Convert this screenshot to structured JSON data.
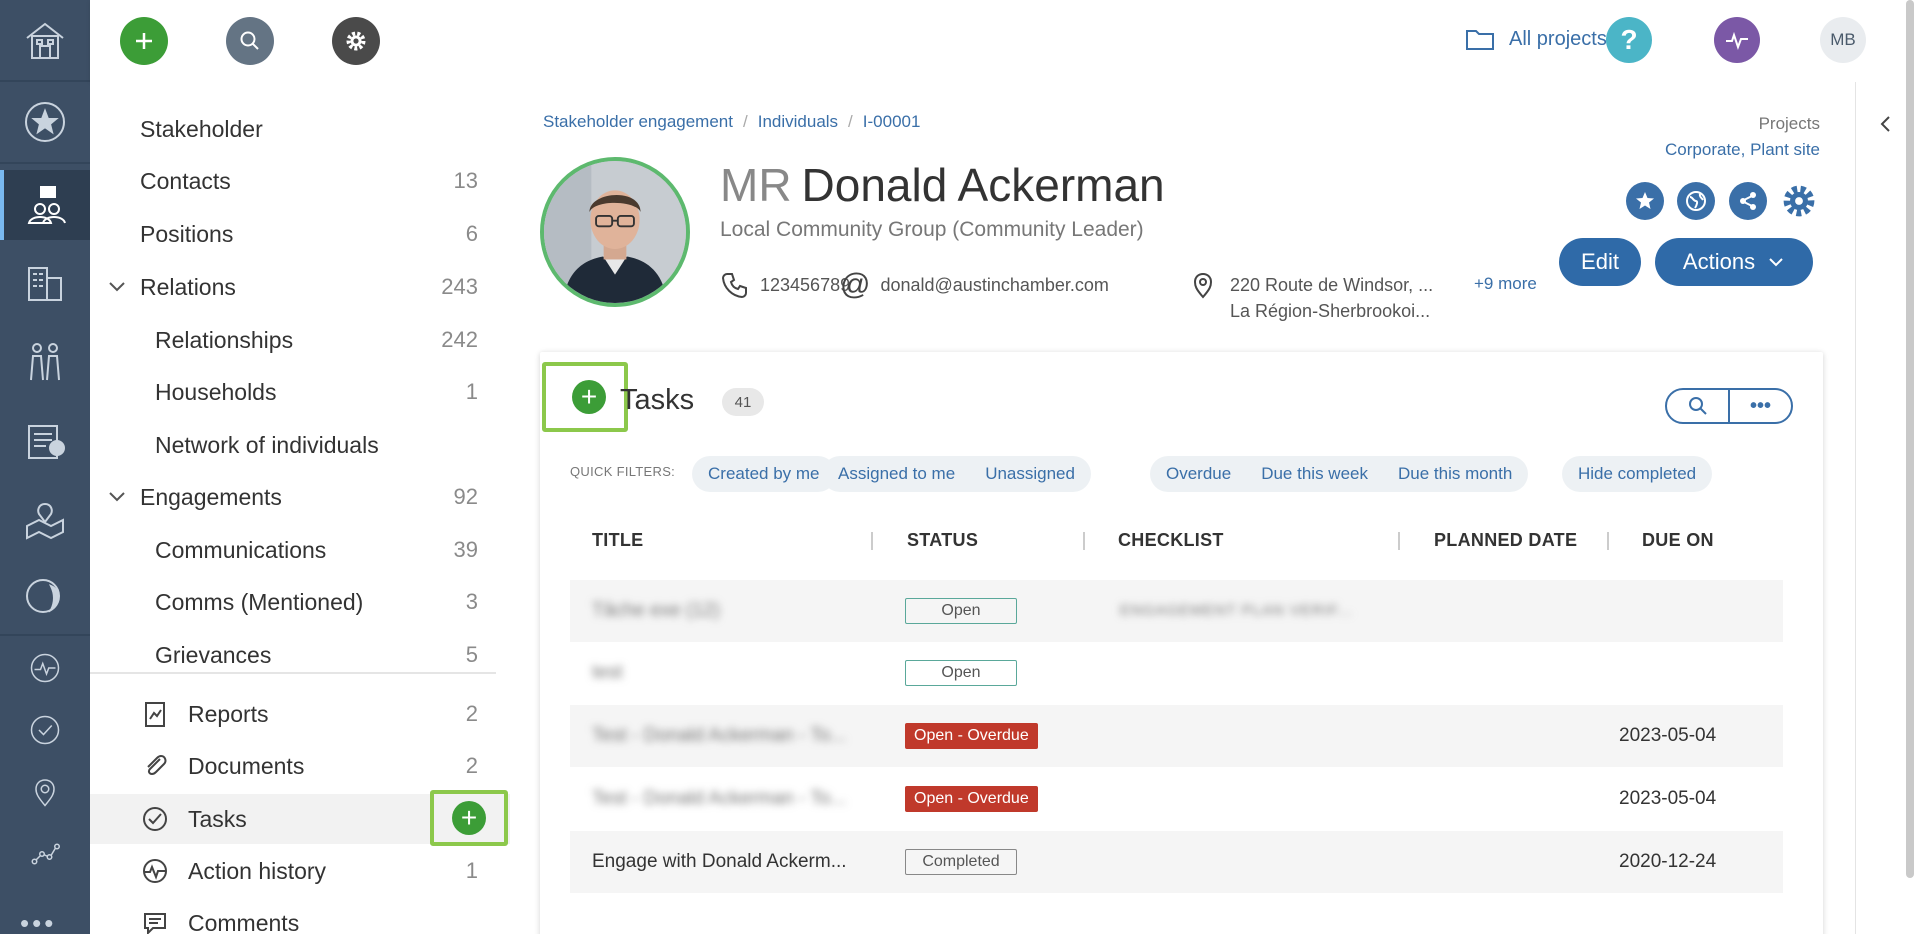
{
  "topbar": {
    "projects_link": "All projects",
    "user_initials": "MB"
  },
  "subnav": {
    "items": [
      {
        "label": "Stakeholder",
        "count": ""
      },
      {
        "label": "Contacts",
        "count": "13"
      },
      {
        "label": "Positions",
        "count": "6"
      },
      {
        "label": "Relations",
        "count": "243"
      },
      {
        "label": "Relationships",
        "count": "242"
      },
      {
        "label": "Households",
        "count": "1"
      },
      {
        "label": "Network of individuals",
        "count": ""
      },
      {
        "label": "Engagements",
        "count": "92"
      },
      {
        "label": "Communications",
        "count": "39"
      },
      {
        "label": "Comms (Mentioned)",
        "count": "3"
      },
      {
        "label": "Grievances",
        "count": "5"
      }
    ],
    "secondary": [
      {
        "label": "Reports",
        "count": "2"
      },
      {
        "label": "Documents",
        "count": "2"
      },
      {
        "label": "Tasks",
        "count": ""
      },
      {
        "label": "Action history",
        "count": "1"
      },
      {
        "label": "Comments",
        "count": ""
      }
    ]
  },
  "breadcrumb": {
    "items": [
      "Stakeholder engagement",
      "Individuals",
      "I-00001"
    ],
    "separator": "/"
  },
  "projects": {
    "label": "Projects",
    "value": "Corporate, Plant site"
  },
  "profile": {
    "title": "MR",
    "name": "Donald Ackerman",
    "org_role": "Local Community Group (Community Leader)",
    "phone": "123456789",
    "email": "donald@austinchamber.com",
    "address_line1": "220 Route de Windsor, ...",
    "address_line2": "La Région-Sherbrookoi...",
    "more": "+9 more"
  },
  "actions": {
    "edit": "Edit",
    "actions": "Actions"
  },
  "tasks": {
    "title": "Tasks",
    "count": "41",
    "quick_filters_label": "QUICK FILTERS:",
    "filters": [
      "Created by me",
      "Assigned to me",
      "Unassigned",
      "Overdue",
      "Due this week",
      "Due this month",
      "Hide completed"
    ],
    "columns": [
      "TITLE",
      "STATUS",
      "CHECKLIST",
      "PLANNED DATE",
      "DUE ON"
    ],
    "rows": [
      {
        "title": "Tâche exe (12)",
        "status": "Open",
        "checklist": "ENGAGEMENT PLAN VERIF...",
        "planned": "",
        "due": ""
      },
      {
        "title": "test",
        "status": "Open",
        "checklist": "",
        "planned": "",
        "due": ""
      },
      {
        "title": "Test - Donald Ackerman - To...",
        "status": "Open - Overdue",
        "checklist": "",
        "planned": "",
        "due": "2023-05-04"
      },
      {
        "title": "Test - Donald Ackerman - To...",
        "status": "Open - Overdue",
        "checklist": "",
        "planned": "",
        "due": "2023-05-04"
      },
      {
        "title": "Engage with Donald Ackerm...",
        "status": "Completed",
        "checklist": "",
        "planned": "",
        "due": "2020-12-24"
      }
    ]
  },
  "colors": {
    "rail": "#3d4f65",
    "accent": "#3a6fa8",
    "green": "#3c9d37",
    "overdue": "#c0392b",
    "highlight": "#8cc84b"
  }
}
